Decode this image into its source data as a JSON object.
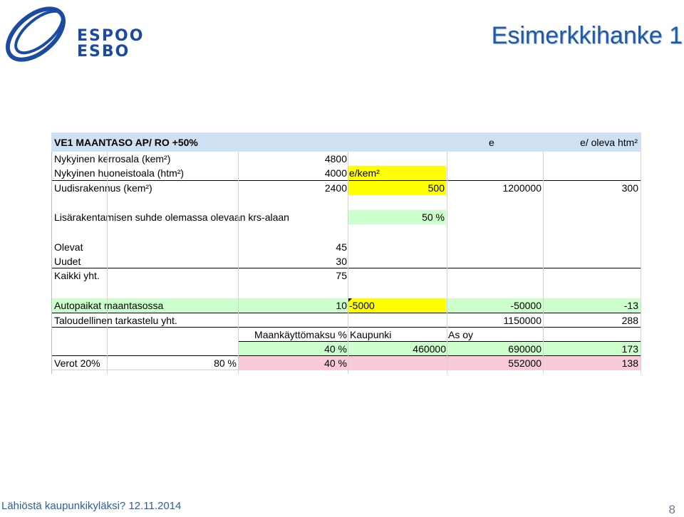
{
  "logo": {
    "line1": "ESPOO",
    "line2": "ESBO"
  },
  "slide": {
    "title": "Esimerkkihanke 1"
  },
  "table": {
    "header": {
      "title": "VE1 MAANTASO AP/ RO +50%",
      "col_e": "e",
      "col_e_per": "e/ oleva htm²"
    },
    "rows": {
      "kerrosala": {
        "label": "Nykyinen kerrosala (kem²)",
        "value": "4800"
      },
      "huoneistoala": {
        "label": "Nykyinen huoneistoala (htm²)",
        "value": "4000",
        "unit": "e/kem²"
      },
      "uudisrakennus": {
        "label": "Uudisrakennus (kem²)",
        "value": "2400",
        "unit_price": "500",
        "total": "1200000",
        "per": "300"
      },
      "suhde": {
        "label": "Lisärakentamisen suhde olemassa olevaan krs-alaan",
        "value": "50 %"
      },
      "olevat": {
        "label": "Olevat",
        "value": "45"
      },
      "uudet": {
        "label": "Uudet",
        "value": "30"
      },
      "kaikki": {
        "label": "Kaikki yht.",
        "value": "75"
      },
      "autopaikat": {
        "label": "Autopaikat maantasossa",
        "count": "10",
        "unit_price": "-5000",
        "total": "-50000",
        "per": "-13"
      },
      "talous": {
        "label": "Taloudellinen tarkastelu yht.",
        "total": "1150000",
        "per": "288"
      },
      "maankaytto_header": {
        "label": "Maankäyttömaksu %",
        "kaupunki": "Kaupunki",
        "as_oy": "As oy"
      },
      "maankaytto": {
        "percent": "40 %",
        "kaupunki": "460000",
        "as_oy": "690000",
        "per": "173"
      },
      "verot": {
        "label": "Verot 20%",
        "share": "80 %",
        "percent": "40 %",
        "as_oy": "552000",
        "per": "138"
      }
    }
  },
  "footer": {
    "text": "Lähiöstä kaupunkikyläksi? 12.11.2014",
    "page": "8"
  },
  "colors": {
    "header_bg": "#cfe0f3",
    "yellow": "#ffff00",
    "green": "#ccffcc",
    "pink": "#f9cad8",
    "brand_blue": "#1b4ba0",
    "title_blue": "#1f5aa8"
  }
}
